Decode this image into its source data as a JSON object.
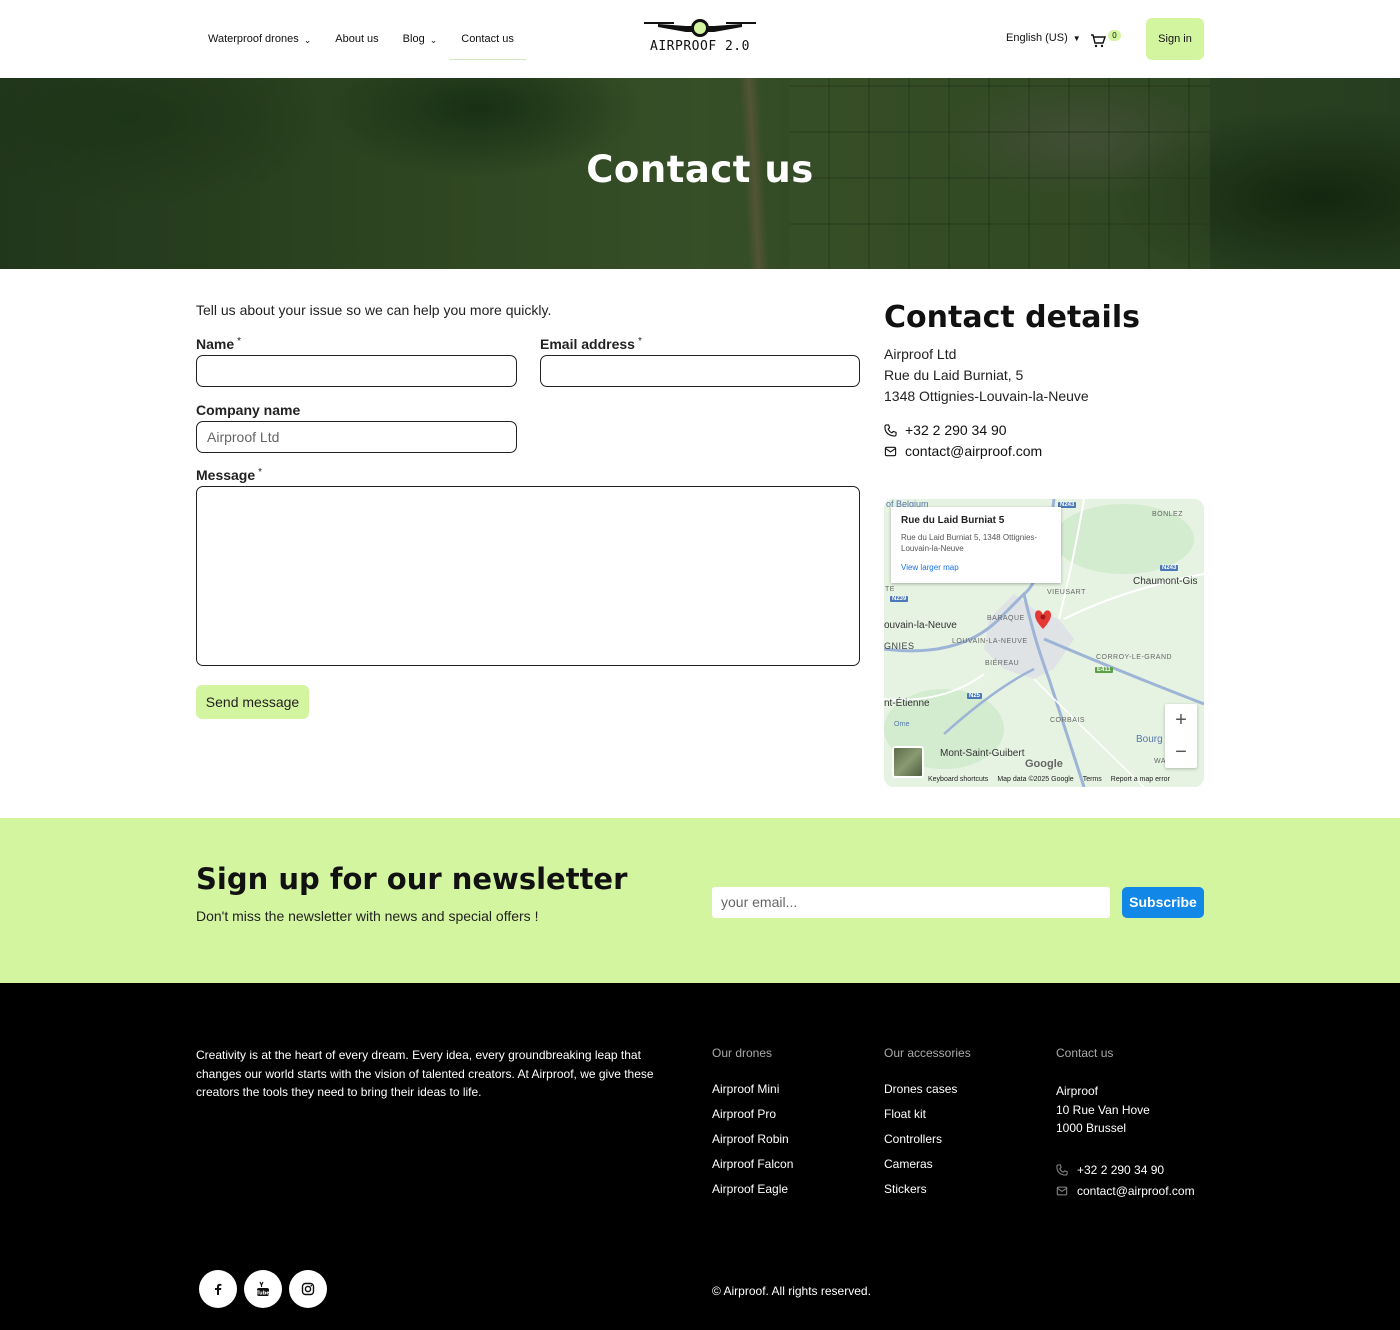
{
  "header": {
    "nav": [
      {
        "label": "Waterproof drones",
        "dropdown": true
      },
      {
        "label": "About us",
        "dropdown": false
      },
      {
        "label": "Blog",
        "dropdown": true
      },
      {
        "label": "Contact us",
        "dropdown": false,
        "active": true
      }
    ],
    "logo_text": "AIRPROOF 2.0",
    "language": "English (US)",
    "cart_count": "0",
    "signin_label": "Sign in"
  },
  "hero": {
    "title": "Contact us"
  },
  "form": {
    "intro": "Tell us about your issue so we can help you more quickly.",
    "name_label": "Name",
    "email_label": "Email address",
    "company_label": "Company name",
    "company_value": "Airproof Ltd",
    "message_label": "Message",
    "required_mark": "*",
    "send_label": "Send message"
  },
  "contact_details": {
    "title": "Contact details",
    "company": "Airproof Ltd",
    "street": "Rue du Laid Burniat, 5",
    "city": "1348 Ottignies-Louvain-la-Neuve",
    "phone": "+32 2 290 34 90",
    "email": "contact@airproof.com"
  },
  "map": {
    "card_title": "Rue du Laid Burniat 5",
    "card_address": "Rue du Laid Burniat 5, 1348 Ottignies-Louvain-la-Neuve",
    "card_link": "View larger map",
    "labels": {
      "belgium": "of Belgium",
      "bonlez": "BONLEZ",
      "chaumont": "Chaumont-Gis",
      "vieusart": "VIEUSART",
      "louvain": "ouvain-la-Neuve",
      "baraque": "BARAQUE",
      "louvain_small": "LOUVAIN-LA-NEUVE",
      "gnies": "GNIES",
      "bierau": "BIÉREAU",
      "corroy": "CORROY-LE-GRAND",
      "etienne": "nt-Étienne",
      "corbais": "CORBAIS",
      "orne": "Orne",
      "bourg": "Bourg",
      "msg": "Mont-Saint-Guibert",
      "wa": "WA",
      "te": "TE",
      "n243a": "N243",
      "n243b": "N243",
      "n239": "N239",
      "e411": "E411",
      "n25": "N25"
    },
    "google": "Google",
    "footer": [
      "Keyboard shortcuts",
      "Map data ©2025 Google",
      "Terms",
      "Report a map error"
    ],
    "zoom_in": "+",
    "zoom_out": "−"
  },
  "newsletter": {
    "title": "Sign up for our newsletter",
    "subtitle": "Don't miss the newsletter with news and special offers !",
    "placeholder": "your email...",
    "button": "Subscribe"
  },
  "footer": {
    "about": "Creativity is at the heart of every dream. Every idea, every groundbreaking leap that changes our world starts with the vision of talented creators. At Airproof, we give these creators the tools they need to bring their ideas to life.",
    "drones": {
      "heading": "Our drones",
      "items": [
        "Airproof Mini",
        "Airproof Pro",
        "Airproof Robin",
        "Airproof Falcon",
        "Airproof Eagle"
      ]
    },
    "accessories": {
      "heading": "Our accessories",
      "items": [
        "Drones cases",
        "Float kit",
        "Controllers",
        "Cameras",
        "Stickers"
      ]
    },
    "contact": {
      "heading": "Contact us",
      "name": "Airproof",
      "street": "10 Rue Van Hove",
      "city": "1000 Brussel",
      "phone": "+32 2 290 34 90",
      "email": "contact@airproof.com"
    },
    "copyright": "© Airproof. All rights reserved.",
    "social": [
      "facebook-icon",
      "youtube-icon",
      "instagram-icon"
    ]
  },
  "colors": {
    "accent_green": "#d4f5a0",
    "subscribe_blue": "#1187e8",
    "footer_bg": "#000000"
  }
}
